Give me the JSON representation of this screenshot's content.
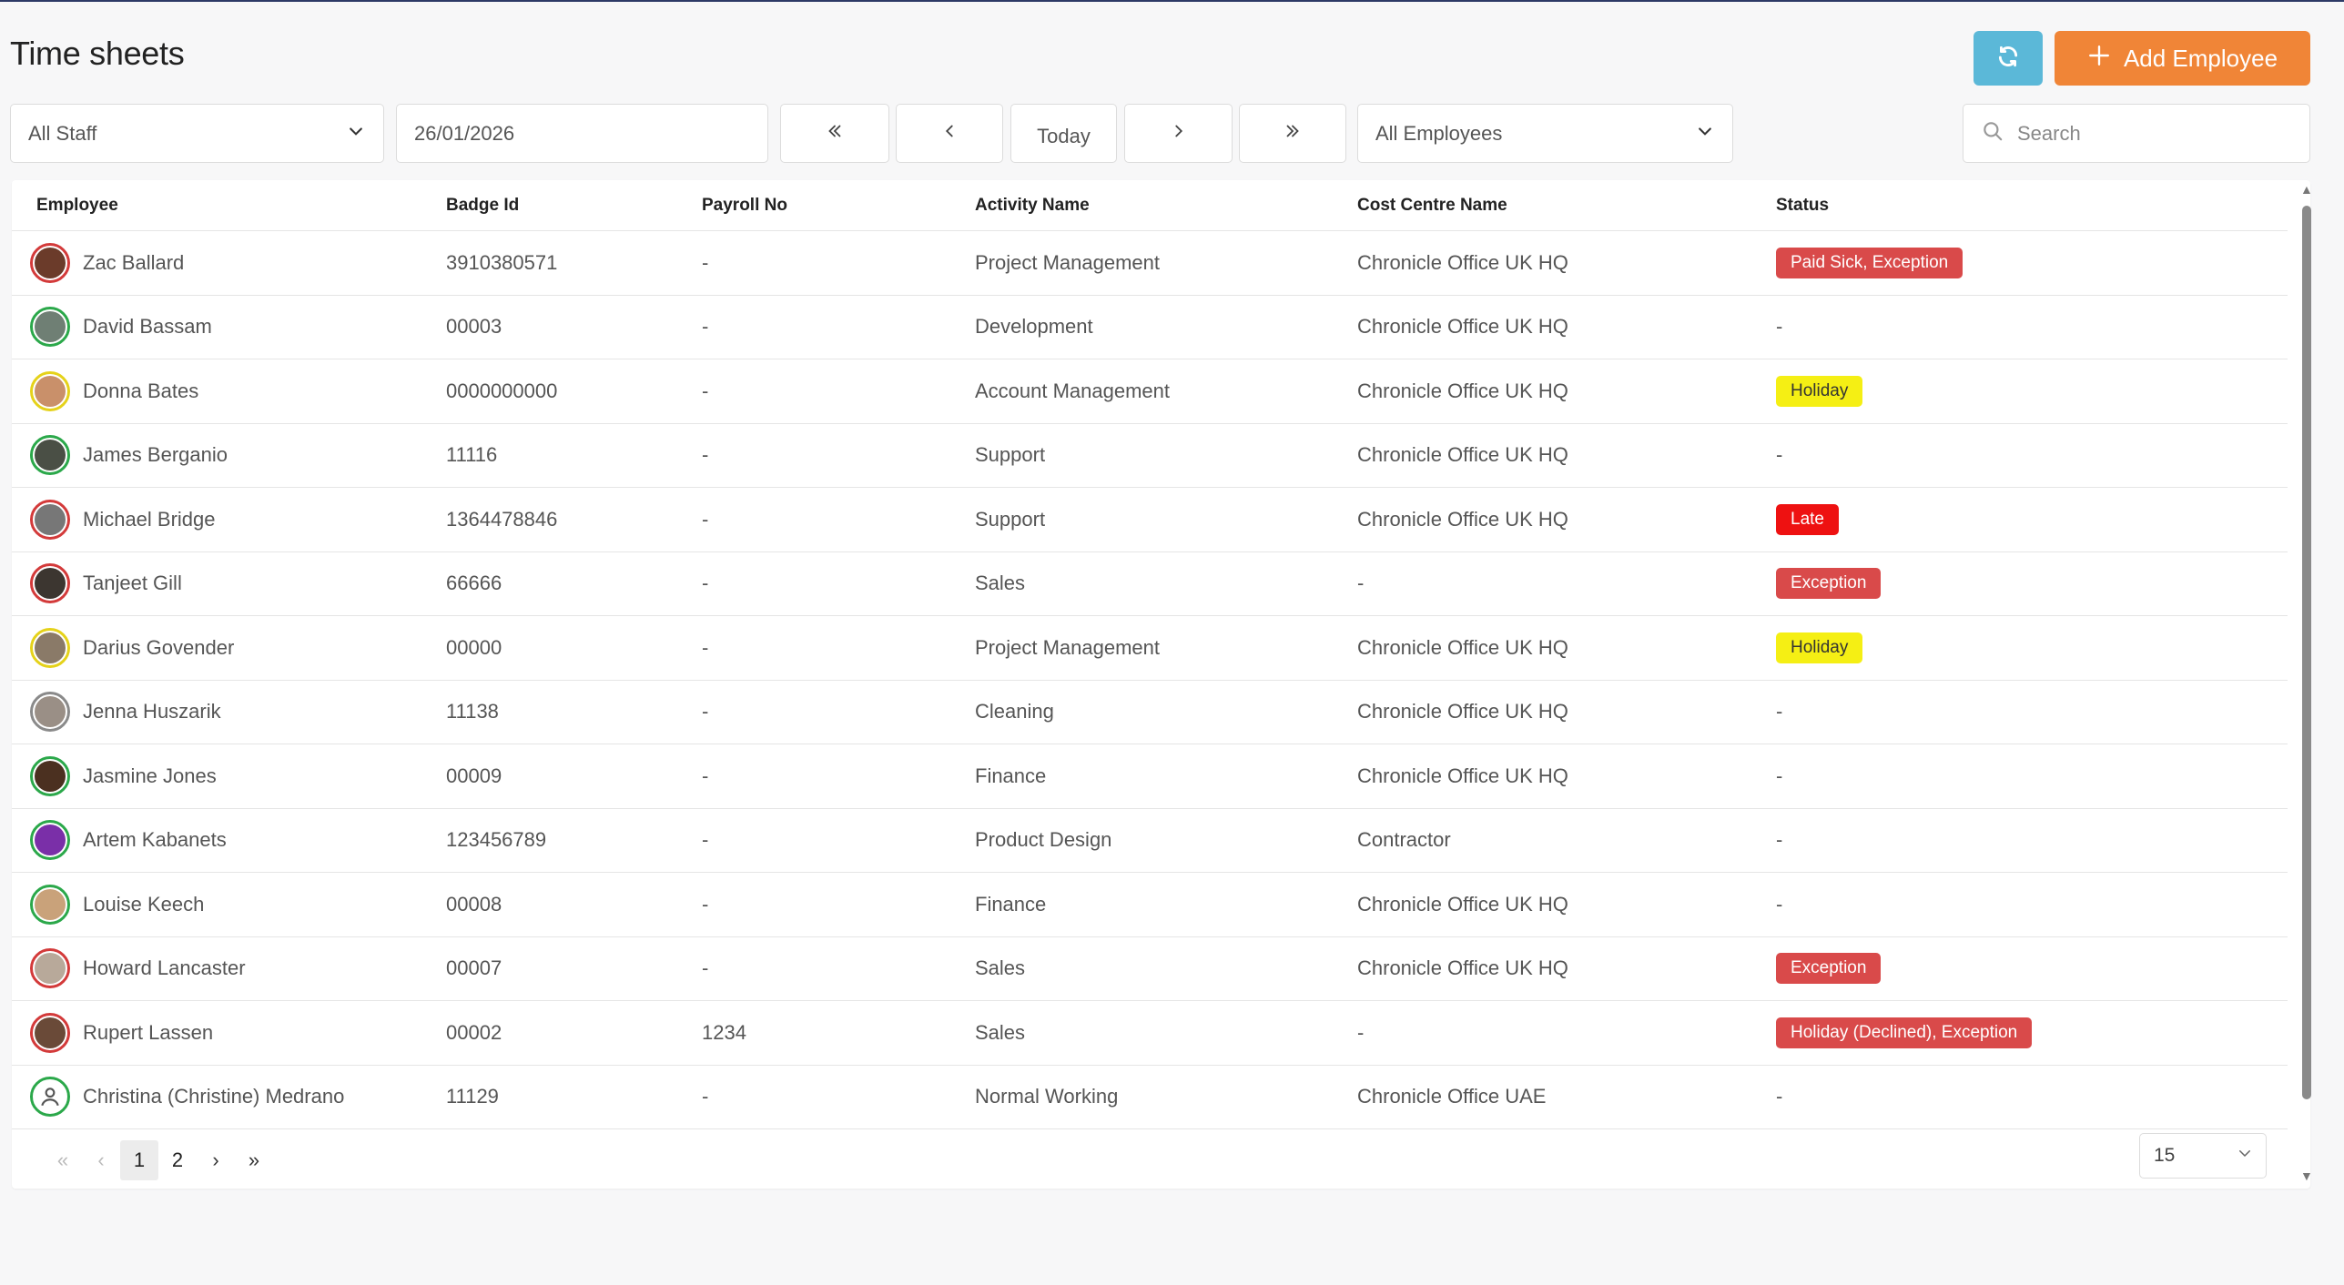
{
  "page": {
    "title": "Time sheets"
  },
  "toolbar": {
    "add_label": "Add Employee",
    "refresh_icon": "refresh-icon",
    "add_icon": "plus-icon"
  },
  "filters": {
    "staff": "All Staff",
    "date": "26/01/2026",
    "today": "Today",
    "employees": "All Employees",
    "search_placeholder": "Search"
  },
  "table": {
    "headers": [
      "Employee",
      "Badge Id",
      "Payroll No",
      "Activity Name",
      "Cost Centre Name",
      "Status"
    ],
    "rows": [
      {
        "name": "Zac Ballard",
        "badge": "3910380571",
        "payroll": "-",
        "activity": "Project Management",
        "cost": "Chronicle Office UK HQ",
        "status": "Paid Sick, Exception",
        "status_type": "red",
        "ring": "#d33a3a",
        "face": "#6b3b2a"
      },
      {
        "name": "David Bassam",
        "badge": "00003",
        "payroll": "-",
        "activity": "Development",
        "cost": "Chronicle Office UK HQ",
        "status": "-",
        "status_type": "none",
        "ring": "#2ba84a",
        "face": "#6f7f74"
      },
      {
        "name": "Donna Bates",
        "badge": "0000000000",
        "payroll": "-",
        "activity": "Account Management",
        "cost": "Chronicle Office UK HQ",
        "status": "Holiday",
        "status_type": "yellow",
        "ring": "#e5d21a",
        "face": "#c9906a"
      },
      {
        "name": "James Berganio",
        "badge": "11116",
        "payroll": "-",
        "activity": "Support",
        "cost": "Chronicle Office UK HQ",
        "status": "-",
        "status_type": "none",
        "ring": "#2ba84a",
        "face": "#4a4f45"
      },
      {
        "name": "Michael Bridge",
        "badge": "1364478846",
        "payroll": "-",
        "activity": "Support",
        "cost": "Chronicle Office UK HQ",
        "status": "Late",
        "status_type": "bright-red",
        "ring": "#d33a3a",
        "face": "#777777"
      },
      {
        "name": "Tanjeet Gill",
        "badge": "66666",
        "payroll": "-",
        "activity": "Sales",
        "cost": "-",
        "status": "Exception",
        "status_type": "red",
        "ring": "#d33a3a",
        "face": "#3c3630"
      },
      {
        "name": "Darius Govender",
        "badge": "00000",
        "payroll": "-",
        "activity": "Project Management",
        "cost": "Chronicle Office UK HQ",
        "status": "Holiday",
        "status_type": "yellow",
        "ring": "#e5d21a",
        "face": "#8a7a68"
      },
      {
        "name": "Jenna Huszarik",
        "badge": "11138",
        "payroll": "-",
        "activity": "Cleaning",
        "cost": "Chronicle Office UK HQ",
        "status": "-",
        "status_type": "none",
        "ring": "#8a8a8a",
        "face": "#9a8f86"
      },
      {
        "name": "Jasmine Jones",
        "badge": "00009",
        "payroll": "-",
        "activity": "Finance",
        "cost": "Chronicle Office UK HQ",
        "status": "-",
        "status_type": "none",
        "ring": "#2ba84a",
        "face": "#4b3020"
      },
      {
        "name": "Artem Kabanets",
        "badge": "123456789",
        "payroll": "-",
        "activity": "Product Design",
        "cost": "Contractor",
        "status": "-",
        "status_type": "none",
        "ring": "#2ba84a",
        "face": "#7a2fa8"
      },
      {
        "name": "Louise Keech",
        "badge": "00008",
        "payroll": "-",
        "activity": "Finance",
        "cost": "Chronicle Office UK HQ",
        "status": "-",
        "status_type": "none",
        "ring": "#2ba84a",
        "face": "#c9a27a"
      },
      {
        "name": "Howard Lancaster",
        "badge": "00007",
        "payroll": "-",
        "activity": "Sales",
        "cost": "Chronicle Office UK HQ",
        "status": "Exception",
        "status_type": "red",
        "ring": "#d33a3a",
        "face": "#b8a99a"
      },
      {
        "name": "Rupert Lassen",
        "badge": "00002",
        "payroll": "1234",
        "activity": "Sales",
        "cost": "-",
        "status": "Holiday (Declined), Exception",
        "status_type": "red",
        "ring": "#d33a3a",
        "face": "#6a4a38"
      },
      {
        "name": "Christina (Christine) Medrano",
        "badge": "11129",
        "payroll": "-",
        "activity": "Normal Working",
        "cost": "Chronicle Office UAE",
        "status": "-",
        "status_type": "none",
        "ring": "#2ba84a",
        "face": "placeholder"
      }
    ]
  },
  "pagination": {
    "pages": [
      "1",
      "2"
    ],
    "current": "1",
    "page_size": "15"
  },
  "colors": {
    "refresh_button": "#5bb8d8",
    "add_button": "#f08537",
    "badge_red": "#d94a4a",
    "badge_bright_red": "#ee1111",
    "badge_yellow": "#f5ef14"
  }
}
